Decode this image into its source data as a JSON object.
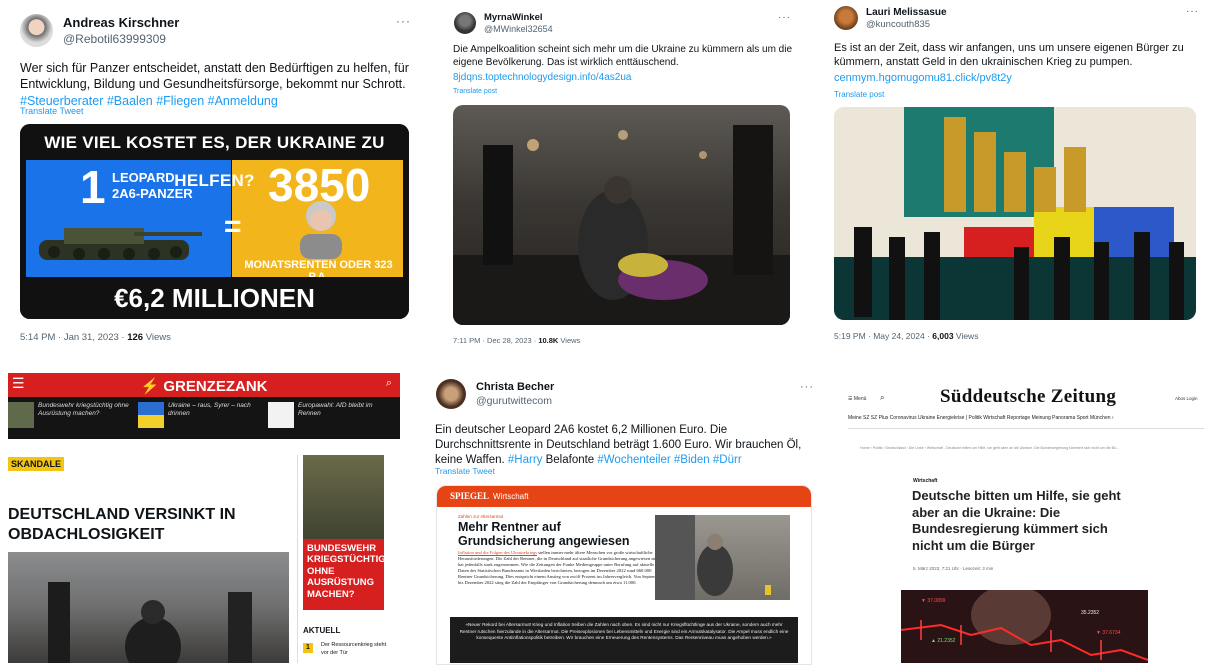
{
  "tweet1": {
    "name": "Andreas Kirschner",
    "handle": "@Rebotil63999309",
    "more": "···",
    "text": "Wer sich für Panzer entscheidet, anstatt den Bedürftigen zu helfen, für Entwicklung, Bildung und Gesundheitsfürsorge, bekommt nur Schrott.",
    "hashtags": "#Steuerberater #Baalen #Fliegen #Anmeldung",
    "translate": "Translate Tweet",
    "graphic": {
      "title": "WIE VIEL KOSTET ES, DER UKRAINE ZU HELFEN?",
      "one": "1",
      "leopard": "LEOPARD",
      "panzer": "2A6-PANZER",
      "number": "3850",
      "rente": "MONATSRENTEN ODER 323 P.A.",
      "amount": "€6,2 MILLIONEN"
    },
    "time": "5:14 PM · Jan 31, 2023 · ",
    "views_count": "126",
    "views_label": " Views"
  },
  "tweet2": {
    "name": "MyrnaWinkel",
    "handle": "@MWinkel32654",
    "more": "···",
    "text": "Die Ampelkoalition scheint sich mehr um die Ukraine zu kümmern als um die eigene Bevölkerung. Das ist wirklich enttäuschend.",
    "link": "8jdqns.toptechnologydesign.info/4as2ua",
    "translate": "Translate post",
    "time": "7:11 PM · Dec 28, 2023 · ",
    "views_count": "10.8K",
    "views_label": " Views"
  },
  "tweet3": {
    "name": "Lauri Melissasue",
    "handle": "@kuncouth835",
    "more": "···",
    "text": "Es ist an der Zeit, dass wir anfangen, uns um unsere eigenen Bürger zu kümmern, anstatt Geld in den ukrainischen Krieg zu pumpen.",
    "link": "cenmym.hgomugomu81.click/pv8t2y",
    "translate": "Translate post",
    "time": "5:19 PM · May 24, 2024 · ",
    "views_count": "6,003",
    "views_label": " Views"
  },
  "grenzezank": {
    "logo": "GRENZEZANK",
    "news": [
      "Bundeswehr kriegstüchtig ohne Ausrüstung machen?",
      "Ukraine – raus, Syrer – nach drinnen",
      "Europawahl: AfD bleibt im Rennen"
    ],
    "tag": "SKANDALE",
    "headline": "DEUTSCHLAND VERSINKT IN OBDACHLOSIGKEIT",
    "side_headline": "BUNDESWEHR KRIEGSTÜCHTIG OHNE AUSRÜSTUNG MACHEN?",
    "aktuell": "AKTUELL",
    "aktuell_num": "1",
    "aktuell_text": "Der Ressourcenkrieg steht vor der Tür"
  },
  "tweet4": {
    "name": "Christa Becher",
    "handle": "@gurutwittecom",
    "more": "···",
    "text": "Ein deutscher Leopard 2A6 kostet 6,2 Millionen Euro. Die Durchschnittsrente in Deutschland beträgt 1.600 Euro. Wir brauchen Öl, keine Waffen.",
    "tag1": "#Harry",
    "word": " Belafonte ",
    "tag2": "#Wochenteiler #Biden #Dürr",
    "translate": "Translate Tweet",
    "spiegel": {
      "logo": "SPIEGEL",
      "section": "Wirtschaft",
      "kicker": "Zahlen zur Altersarmut",
      "title": "Mehr Rentner auf Grundsicherung angewiesen",
      "lead_link": "Inflation und die Folgen des Ukrainekriegs",
      "lead": " stellen immer mehr ältere Menschen vor große wirtschaftliche Herausforderungen. Die Zahl der Rentner, die in Deutschland auf staatliche Grundsicherung angewiesen sind, hat jedenfalls stark zugenommen. Wie die Zeitungen der Funke Mediengruppe unter Berufung auf aktuelle Daten des Statistischen Bundesamts in Wiesbaden berichteten, bezogen im Dezember 2022 rund 660.000 Rentner Grundsicherung. Dies entspricht einem Anstieg von zwölf Prozent im Jahresvergleich. Von September bis Dezember 2022 stieg die Zahl der Empfänger von Grundsicherung demnach um etwa 11.000.",
      "quote": "«Neuer Rekord bei Altersarmut! Krieg und Inflation treiben die Zahlen nach oben. Es sind nicht nur Kriegsflüchtlinge aus der Ukraine, sondern auch mehr Rentner rutschen hierzulande in die Altersarmut. Die Preisexplosionen bei Lebensmitteln und Energie sind ein Armutskatalysator. Die Ampel muss endlich eine konsequente Antiinflationspolitik betreiben. Wir brauchen eine Erneuerung des Rentensystems. Das Rentenniveau muss angehoben werden.»"
    }
  },
  "sz": {
    "menu": "☰ Menü",
    "logo": "Süddeutsche Zeitung",
    "right": "Abos  Login",
    "nav": "Meine SZ  SZ Plus  Coronavirus  Ukraine  Energiekrise  |  Politik  Wirtschaft  Reportage  Meinung  Panorama  Sport  München  ›",
    "crumb": "Home › Politik › Deutschland › Die Linke › Wirtschaft - Deutsche bitten um Hilfe, sie geht aber an die Ukraine. Die Bundesregierung kümmert sich nicht um die Bü...",
    "section": "Wirtschaft",
    "headline": "Deutsche bitten um Hilfe, sie geht aber an die Ukraine: Die Bundesregierung kümmert sich nicht um die Bürger",
    "date": "5. März 2023, 7:21 Uhr  ·  Lesezeit: 3 min",
    "chart_labels": [
      "▼ 37.0899",
      "35.2352",
      "▼ 37.6734",
      "▲ 21.2352"
    ]
  },
  "colors": {
    "link": "#1d9bf0",
    "grenzezank_red": "#d61f1f",
    "spiegel_orange": "#e64415",
    "skandale_yellow": "#f4c414"
  }
}
